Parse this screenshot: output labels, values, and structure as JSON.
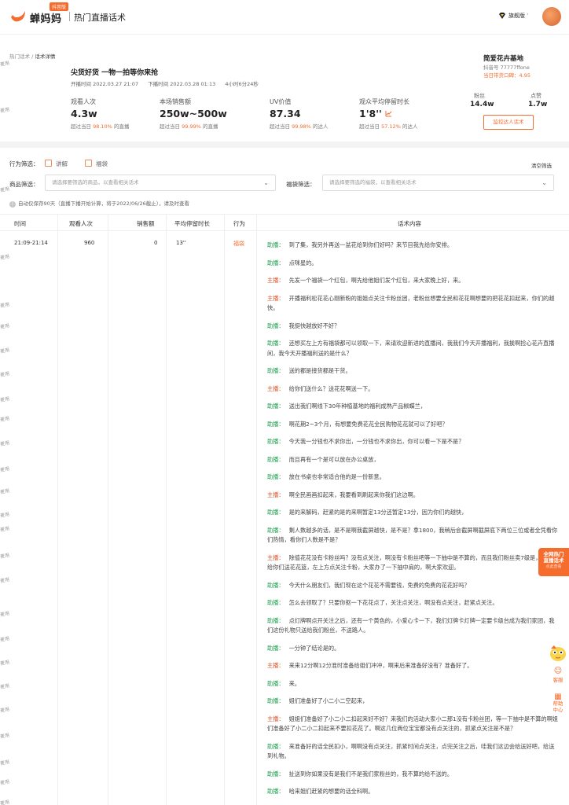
{
  "header": {
    "logo_text": "蝉妈妈",
    "logo_badge": "抖音版",
    "app_title": "热门直播话术",
    "vip_label": "旗舰版",
    "vip_caret": "›"
  },
  "watermark": "麦用",
  "breadcrumb": {
    "parent": "热门话术",
    "sep": " / ",
    "current": "话术详情"
  },
  "live": {
    "title": "尖货好货 一物一拍等你来抢",
    "start": "开播时间 2022.03.27 21:07",
    "end": "下播时间 2022.03.28 01:13",
    "duration": "4小时6分24秒"
  },
  "stats": [
    {
      "label": "观看人次",
      "value": "4.3w",
      "sub_prefix": "超过当日",
      "pct": "98.10%",
      "sub_suffix": "的直播"
    },
    {
      "label": "本场销售额",
      "value": "250w~500w",
      "sub_prefix": "超过当日",
      "pct": "99.99%",
      "sub_suffix": "的直播"
    },
    {
      "label": "UV价值",
      "value": "87.34",
      "sub_prefix": "超过当日",
      "pct": "99.98%",
      "sub_suffix": "的达人"
    },
    {
      "label": "观众平均停留时长",
      "value": "1'8''",
      "sub_prefix": "超过当日",
      "pct": "57.12%",
      "sub_suffix": "的达人"
    }
  ],
  "anchor": {
    "name": "简爱花卉基地",
    "id": "抖音号 77777ffone",
    "score": "当日带货口碑：4.95",
    "fans_label": "粉丝",
    "fans_value": "14.4w",
    "likes_label": "点赞",
    "likes_value": "1.7w",
    "monitor_button": "监控达人话术"
  },
  "filters": {
    "behavior_label": "行为筛选：",
    "opt1": "讲解",
    "opt2": "福袋",
    "clear": "清空筛选",
    "product_label": "商品筛选：",
    "product_placeholder": "请选择要筛选的商品，以查看相关话术",
    "bag_label": "福袋筛选：",
    "bag_placeholder": "请选择要筛选的福袋，以查看相关话术",
    "notice": "自动仅保存90天（直播下播开始计算，将于2022/06/26截止），请及时查看"
  },
  "table": {
    "headers": [
      "时间",
      "观看人次",
      "销售额",
      "平均停留时长",
      "行为",
      "话术内容"
    ],
    "row": {
      "time": "21:09-21:14",
      "views": "960",
      "sales": "0",
      "stay": "13''",
      "action": "福袋"
    }
  },
  "script_lines": [
    {
      "role": "assist",
      "speaker": "助播：",
      "text": "到了集，我另外再送一盆花给到你们好吗？来节目我先给你安排。"
    },
    {
      "role": "assist",
      "speaker": "助播：",
      "text": "点咪星的。"
    },
    {
      "role": "host",
      "speaker": "主播：",
      "text": "先发一个福袋一个红包，啊先给他姐们发个红包，来大家晚上好，来。"
    },
    {
      "role": "host",
      "speaker": "主播：",
      "text": "开播福利松花花心刚新粉的姐姐点关注卡粉丝团，老粉丝想要全民和花花啊想要的把花花扣起来，你们的越快。"
    },
    {
      "role": "assist",
      "speaker": "助播：",
      "text": "我挺快越放好不好？"
    },
    {
      "role": "assist",
      "speaker": "助播：",
      "text": "还想买左上方有福袋都可以领取一下，来请欢迎新进的直播间，我我们今天开播福利，我挨啊捡心花卉直播间，我今天开播福利送的是什么？"
    },
    {
      "role": "assist",
      "speaker": "助播：",
      "text": "送的都是接货都是干货。"
    },
    {
      "role": "host",
      "speaker": "主播：",
      "text": "给你们送什么？送花花啊送一下。"
    },
    {
      "role": "assist",
      "speaker": "助播：",
      "text": "送出我们啊线下30年种植基地的福利成熟产品椒蝶兰，"
    },
    {
      "role": "assist",
      "speaker": "助播：",
      "text": "啊花期2~3个月，有想要免费花花全民购物花花就可以了好吧？"
    },
    {
      "role": "assist",
      "speaker": "助播：",
      "text": "今天我一分钱也不求你出，一分钱也不求你出，你可以看一下是不是？"
    },
    {
      "role": "assist",
      "speaker": "助播：",
      "text": "而且再有一个是可以放在办公桌放，"
    },
    {
      "role": "assist",
      "speaker": "助播：",
      "text": "放在书桌也非常适合他的是一份新意。"
    },
    {
      "role": "host",
      "speaker": "主播：",
      "text": "啊全民画画扣起来，我要看到刷起来你我们这边啊。"
    },
    {
      "role": "assist",
      "speaker": "助播：",
      "text": "是的来解码，赶紧的是的来啊暂定13分还暂定13分，因为你们的越快，"
    },
    {
      "role": "assist",
      "speaker": "助播：",
      "text": "剩人数越多的话，是不是啊我截屏越快，是不是？拿1800，我稍后会截屏啊截屏底下两位三位或者全凭看你们热情，看你们人数是不是？"
    },
    {
      "role": "host",
      "speaker": "主播：",
      "text": "除值花花没有卡粉丝吗？没有点关注，啊没有卡粉丝吧等一下抽中是不算的，而且我们粉丝卖7级是，另外再给你们送花花篮，左上方点关注卡粉，大家办了一下抽中肩的，啊大家欢迎。"
    },
    {
      "role": "assist",
      "speaker": "助播：",
      "text": "今天什么朋友们，我们现在这个花花不需要钱，免费的免费的花花好吗？"
    },
    {
      "role": "assist",
      "speaker": "助播：",
      "text": "怎么去领取了？只要你抠一下花花点了，关注点关注，啊没有点关注，赶紧点关注。"
    },
    {
      "role": "assist",
      "speaker": "助播：",
      "text": "点灯牌啊点开关注之后，还有一个黄色的，小爱心卡一下，我们灯牌卡灯牌一定要卡级台成为我们家团，我们这份礼物只送给我们粉丝，不送路人。"
    },
    {
      "role": "assist",
      "speaker": "助播：",
      "text": "一分钟了结论是的。"
    },
    {
      "role": "host",
      "speaker": "主播：",
      "text": "来来12分啊12分准时准备给姐们冲冲，啊来后来准备好没有？准备好了。"
    },
    {
      "role": "assist",
      "speaker": "助播：",
      "text": "来。"
    },
    {
      "role": "assist",
      "speaker": "助播：",
      "text": "姐们准备好了小二小二空起来，"
    },
    {
      "role": "host",
      "speaker": "主播：",
      "text": "姐姐们准备好了小二小二扣起来好不好？来我们的活动大家小二那1没有卡粉丝团，等一下抽中是不算的啊姐们准备好了小二小二扣起来不要扣花花了。啊这几位两位宝宝都没有点关注的，抓紧点关注是不是？"
    },
    {
      "role": "assist",
      "speaker": "助播：",
      "text": "来准备好的话全民扣小，啊啊没有点关注，抓紧时间点关注，点完关注之后，哇我们这边会给送好吧，给送到礼物。"
    },
    {
      "role": "assist",
      "speaker": "助播：",
      "text": "扯送到你如果没有是我们不是我们家粉丝的，我不算的给不送的。"
    },
    {
      "role": "assist",
      "speaker": "助播：",
      "text": "哈来姐们赶紧的想要的话全科啊。"
    }
  ],
  "side": {
    "badge_line1": "全网热门",
    "badge_line2": "直播话术",
    "badge_small": "点此查看",
    "tool1": "客服",
    "tool2": "帮助中心"
  },
  "colors": {
    "brand": "#f56c2d",
    "assist": "#1a9e4a",
    "host": "#e0542a"
  }
}
